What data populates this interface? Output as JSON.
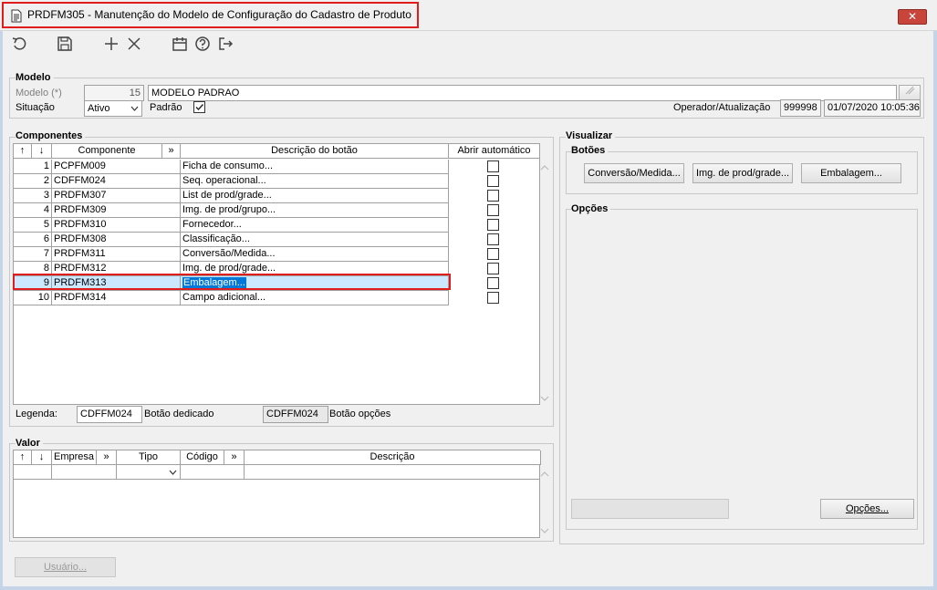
{
  "window": {
    "title": "PRDFM305 - Manutenção do Modelo de Configuração do Cadastro de Produto",
    "close_label": "✕"
  },
  "toolbar": {
    "icons": [
      "undo-icon",
      "save-icon",
      "add-icon",
      "delete-icon",
      "calendar-icon",
      "help-icon",
      "exit-icon"
    ]
  },
  "modelo": {
    "group_title": "Modelo",
    "modelo_label": "Modelo (*)",
    "modelo_code": "15",
    "modelo_name": "MODELO PADRAO",
    "situacao_label": "Situação",
    "situacao_value": "Ativo",
    "padrao_label": "Padrão",
    "padrao_checked": true,
    "operador_label": "Operador/Atualização",
    "operador_value": "999998",
    "atualizacao_value": "01/07/2020 10:05:36"
  },
  "componentes": {
    "group_title": "Componentes",
    "headers": {
      "up": "↑",
      "down": "↓",
      "componente": "Componente",
      "more": "»",
      "descricao": "Descrição do botão",
      "abrir": "Abrir automático"
    },
    "rows": [
      {
        "num": "1",
        "code": "PCPFM009",
        "desc": "Ficha de consumo..."
      },
      {
        "num": "2",
        "code": "CDFFM024",
        "desc": "Seq. operacional..."
      },
      {
        "num": "3",
        "code": "PRDFM307",
        "desc": "List de prod/grade..."
      },
      {
        "num": "4",
        "code": "PRDFM309",
        "desc": "Img. de prod/grupo..."
      },
      {
        "num": "5",
        "code": "PRDFM310",
        "desc": "Fornecedor..."
      },
      {
        "num": "6",
        "code": "PRDFM308",
        "desc": "Classificação..."
      },
      {
        "num": "7",
        "code": "PRDFM311",
        "desc": "Conversão/Medida..."
      },
      {
        "num": "8",
        "code": "PRDFM312",
        "desc": "Img. de prod/grade..."
      },
      {
        "num": "9",
        "code": "PRDFM313",
        "desc": "Embalagem..."
      },
      {
        "num": "10",
        "code": "PRDFM314",
        "desc": "Campo adicional..."
      }
    ],
    "legenda_label": "Legenda:",
    "legenda_dedicado_value": "CDFFM024",
    "legenda_dedicado_label": "Botão dedicado",
    "legenda_opcoes_value": "CDFFM024",
    "legenda_opcoes_label": "Botão opções"
  },
  "valor": {
    "group_title": "Valor",
    "headers": {
      "up": "↑",
      "down": "↓",
      "empresa": "Empresa",
      "more1": "»",
      "tipo": "Tipo",
      "codigo": "Código",
      "more2": "»",
      "descricao": "Descrição"
    }
  },
  "visualizar": {
    "group_title": "Visualizar",
    "botoes_title": "Botões",
    "botoes": [
      "Conversão/Medida...",
      "Img. de prod/grade...",
      "Embalagem..."
    ],
    "opcoes_title": "Opções",
    "opcoes_button": "Opções..."
  },
  "footer": {
    "usuario_button": "Usuário..."
  },
  "colors": {
    "highlight_outline": "#e01c1c",
    "selection": "#cce8ff",
    "selected_text_bg": "#0078d7"
  }
}
